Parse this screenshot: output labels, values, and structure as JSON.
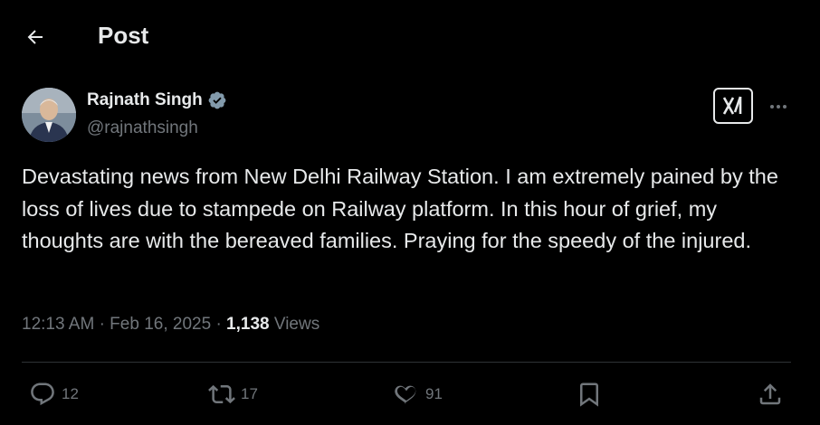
{
  "header": {
    "title": "Post",
    "back_icon": "arrow-left-icon"
  },
  "author": {
    "name": "Rajnath Singh",
    "handle": "@rajnathsingh",
    "verified": true,
    "verified_color": "#829aab"
  },
  "tweet": {
    "text": "Devastating news from New Delhi Railway Station. I am extremely pained by the loss of lives due to stampede on Railway platform. In this hour of grief, my thoughts are with the bereaved families. Praying for the speedy of the injured.",
    "time": "12:13 AM",
    "date": "Feb 16, 2025",
    "views_count": "1,138",
    "views_label": "Views"
  },
  "actions": {
    "replies": "12",
    "reposts": "17",
    "likes": "91"
  },
  "icons": {
    "grok": "grok-icon",
    "more": "more-icon",
    "reply": "reply-icon",
    "repost": "repost-icon",
    "like": "heart-icon",
    "bookmark": "bookmark-icon",
    "share": "share-icon"
  }
}
